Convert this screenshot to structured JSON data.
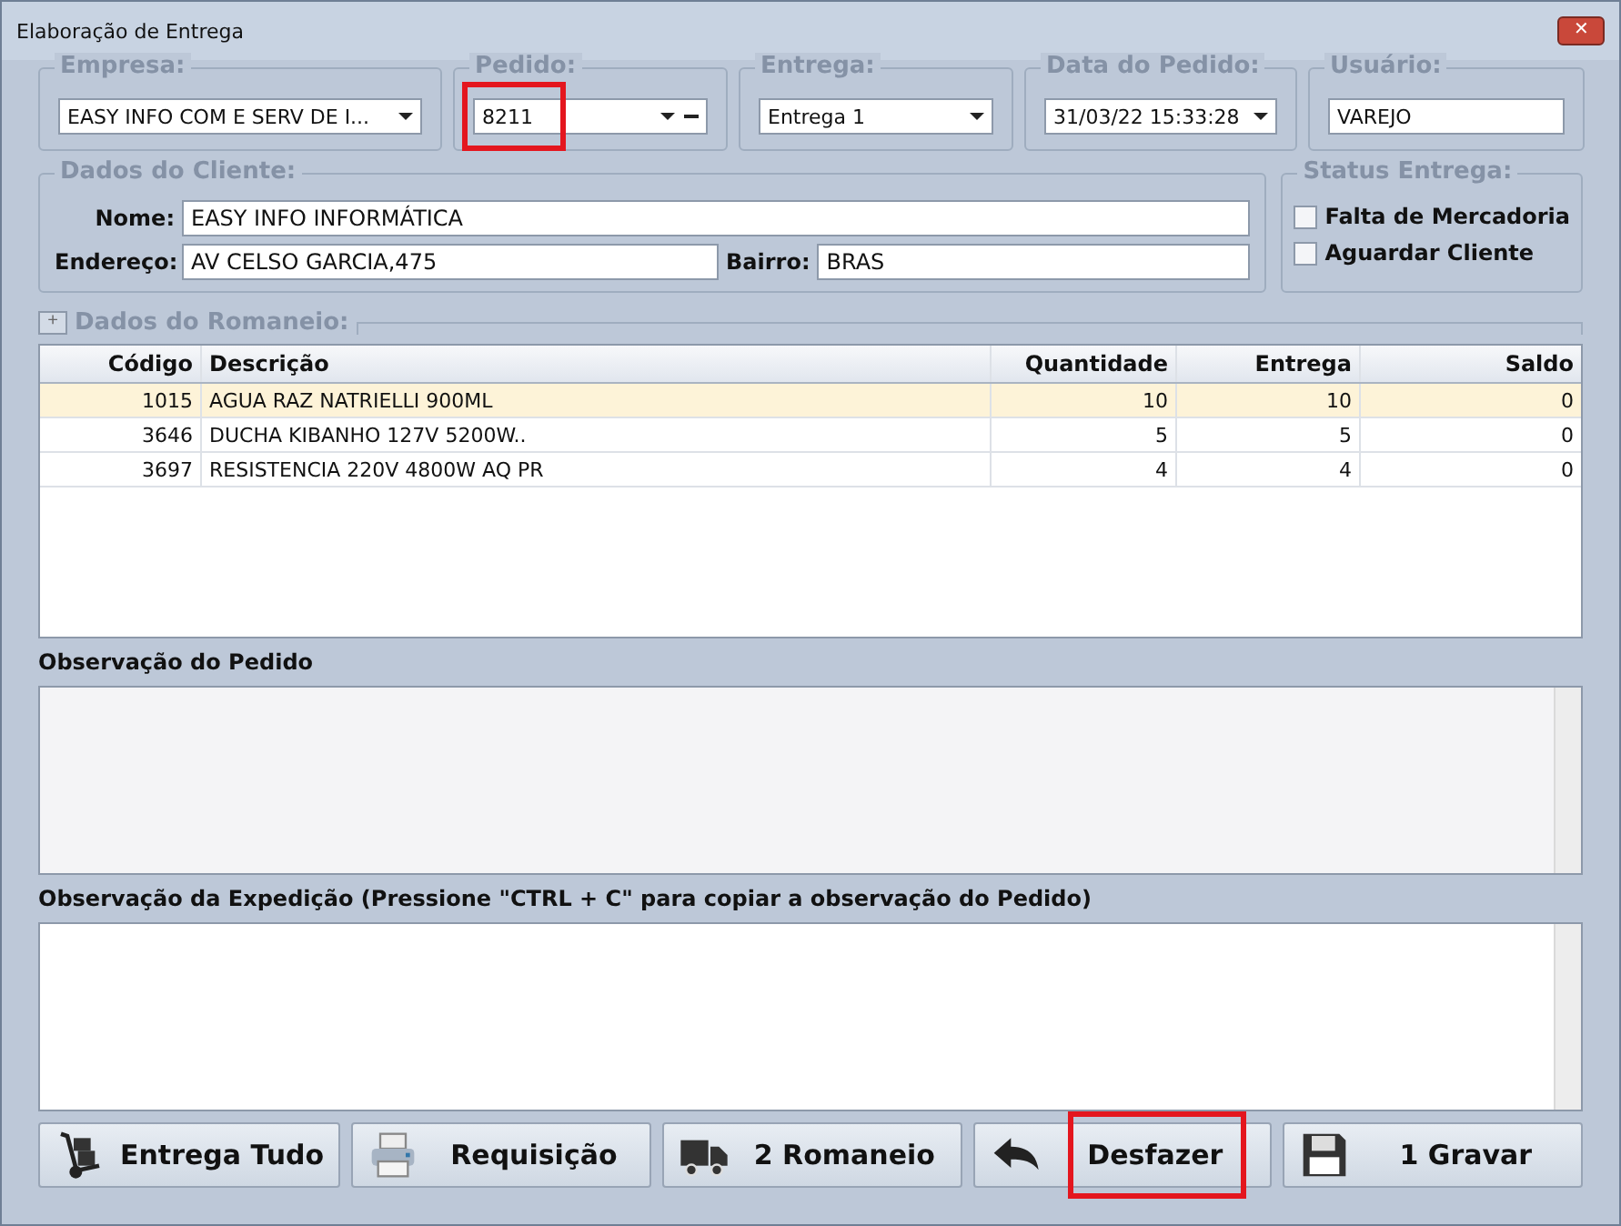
{
  "window": {
    "title": "Elaboração de Entrega",
    "close": "✕"
  },
  "header_fields": [
    {
      "label": "Empresa:",
      "value": "EASY INFO COM E SERV DE I...",
      "kind": "dropdown",
      "highlighted": false
    },
    {
      "label": "Pedido:",
      "value": "8211",
      "kind": "lookup",
      "highlighted": true
    },
    {
      "label": "Entrega:",
      "value": "Entrega 1",
      "kind": "dropdown",
      "highlighted": false
    },
    {
      "label": "Data do Pedido:",
      "value": "31/03/22 15:33:28",
      "kind": "dropdown",
      "highlighted": false
    },
    {
      "label": "Usuário:",
      "value": "VAREJO",
      "kind": "text",
      "highlighted": false
    }
  ],
  "client": {
    "title": "Dados do Cliente:",
    "nome_label": "Nome:",
    "nome": "EASY INFO INFORMÁTICA",
    "endereco_label": "Endereço:",
    "endereco": "AV CELSO GARCIA,475",
    "bairro_label": "Bairro:",
    "bairro": "BRAS"
  },
  "status": {
    "title": "Status Entrega:",
    "options": [
      {
        "label": "Falta de Mercadoria",
        "checked": false
      },
      {
        "label": "Aguardar Cliente",
        "checked": false
      }
    ]
  },
  "romaneio": {
    "expand": "+",
    "title": "Dados do Romaneio:"
  },
  "table": {
    "columns": [
      "Código",
      "Descrição",
      "Quantidade",
      "Entrega",
      "Saldo"
    ],
    "rows": [
      {
        "cells": [
          "1015",
          "AGUA RAZ NATRIELLI 900ML",
          "10",
          "10",
          "0"
        ],
        "selected": true
      },
      {
        "cells": [
          "3646",
          "DUCHA KIBANHO 127V 5200W..",
          "5",
          "5",
          "0"
        ],
        "selected": false
      },
      {
        "cells": [
          "3697",
          "RESISTENCIA 220V 4800W AQ PR",
          "4",
          "4",
          "0"
        ],
        "selected": false
      }
    ]
  },
  "obs_pedido": {
    "label": "Observação do Pedido"
  },
  "obs_expedicao": {
    "label": "Observação da Expedição (Pressione \"CTRL + C\" para copiar a observação do Pedido)"
  },
  "buttons": [
    {
      "label": "Entrega Tudo",
      "highlighted": false
    },
    {
      "label": "Requisição",
      "highlighted": false
    },
    {
      "label": "2 Romaneio",
      "highlighted": false
    },
    {
      "label": "Desfazer",
      "highlighted": true
    },
    {
      "label": "1 Gravar",
      "highlighted": false
    }
  ]
}
